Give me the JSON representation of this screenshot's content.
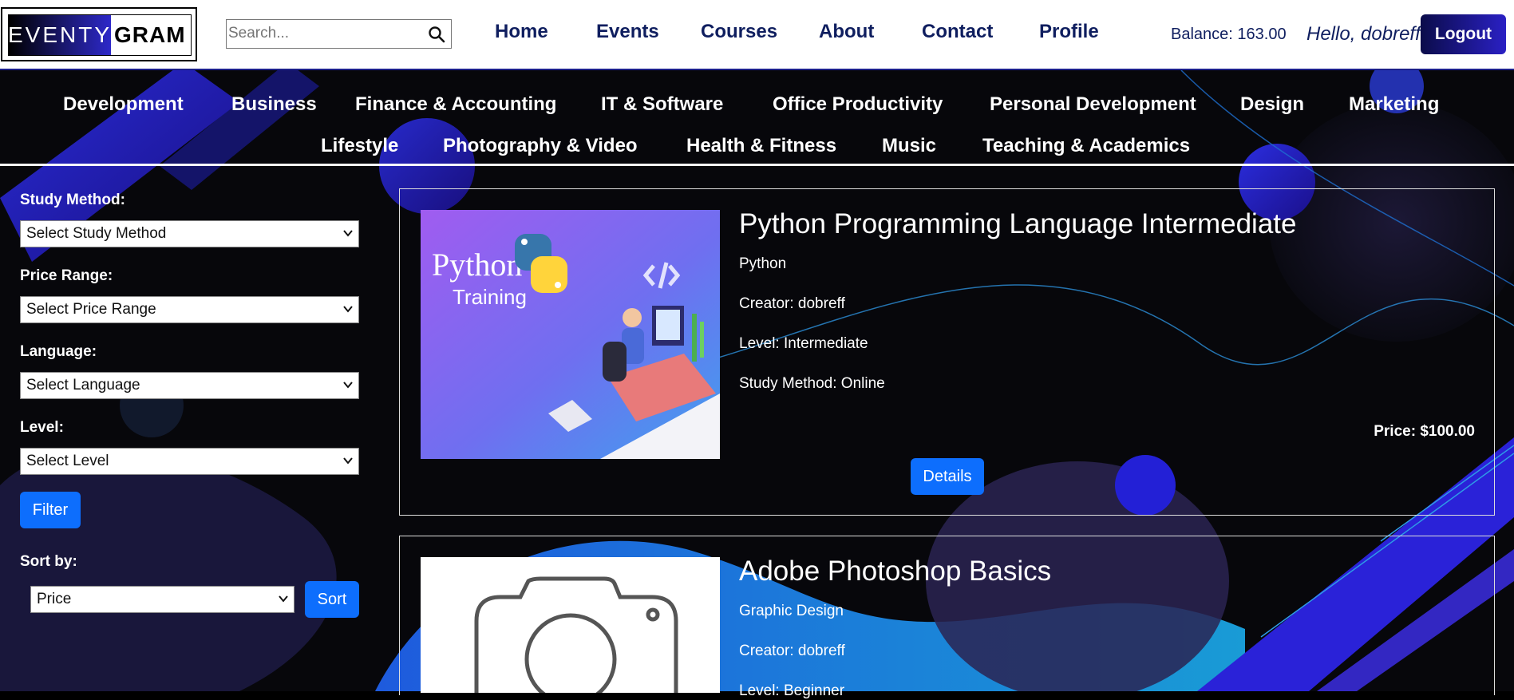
{
  "header": {
    "logo_left": "EVENTY",
    "logo_right": "GRAM",
    "search_placeholder": "Search...",
    "nav": [
      "Home",
      "Events",
      "Courses",
      "About",
      "Contact",
      "Profile"
    ],
    "balance": "Balance: 163.00",
    "greeting": "Hello, dobreff",
    "logout_label": "Logout"
  },
  "categories": [
    "Development",
    "Business",
    "Finance & Accounting",
    "IT & Software",
    "Office Productivity",
    "Personal Development",
    "Design",
    "Marketing",
    "Lifestyle",
    "Photography & Video",
    "Health & Fitness",
    "Music",
    "Teaching & Academics"
  ],
  "filters": {
    "study_method_label": "Study Method:",
    "study_method_value": "Select Study Method",
    "price_range_label": "Price Range:",
    "price_range_value": "Select Price Range",
    "language_label": "Language:",
    "language_value": "Select Language",
    "level_label": "Level:",
    "level_value": "Select Level",
    "filter_button": "Filter",
    "sort_label": "Sort by:",
    "sort_value": "Price",
    "sort_button": "Sort"
  },
  "courses": [
    {
      "title": "Python Programming Language Intermediate",
      "category": "Python",
      "creator": "Creator: dobreff",
      "level": "Level: Intermediate",
      "study_method": "Study Method: Online",
      "price": "Price: $100.00",
      "details_label": "Details",
      "thumb_text_1": "Python",
      "thumb_text_2": "Training"
    },
    {
      "title": "Adobe Photoshop Basics",
      "category": "Graphic Design",
      "creator": "Creator: dobreff",
      "level": "Level: Beginner"
    }
  ],
  "colors": {
    "brand_navy": "#0f1e5f",
    "accent_blue": "#0d6efd",
    "logout_gradient_start": "#0b0c4a",
    "logout_gradient_end": "#2a20c4"
  }
}
